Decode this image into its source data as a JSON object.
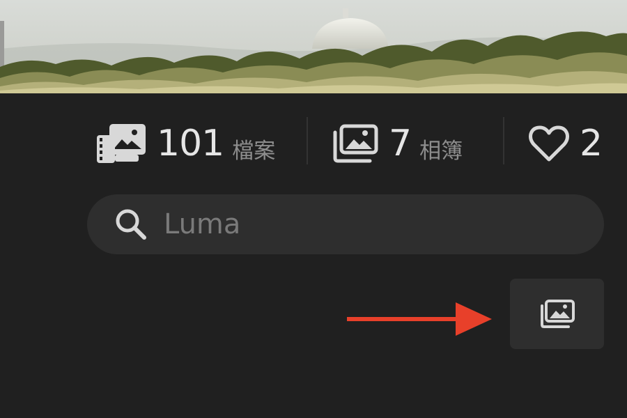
{
  "banner": {
    "description_icon": "landscape-photo"
  },
  "stats": {
    "files": {
      "icon": "media-library-icon",
      "count": "101",
      "label": "檔案"
    },
    "albums": {
      "icon": "photo-stack-icon",
      "count": "7",
      "label": "相簿"
    },
    "favorites": {
      "icon": "heart-icon",
      "count": "2"
    }
  },
  "search": {
    "icon": "search-icon",
    "placeholder": "Luma",
    "value": ""
  },
  "albums_button": {
    "icon": "photo-stack-icon"
  },
  "annotation": {
    "icon": "arrow-right-icon",
    "color": "#e8402a"
  },
  "colors": {
    "background": "#202020",
    "surface": "#2e2e2e",
    "text": "#e6e6e6",
    "muted": "#8d8d8d"
  }
}
